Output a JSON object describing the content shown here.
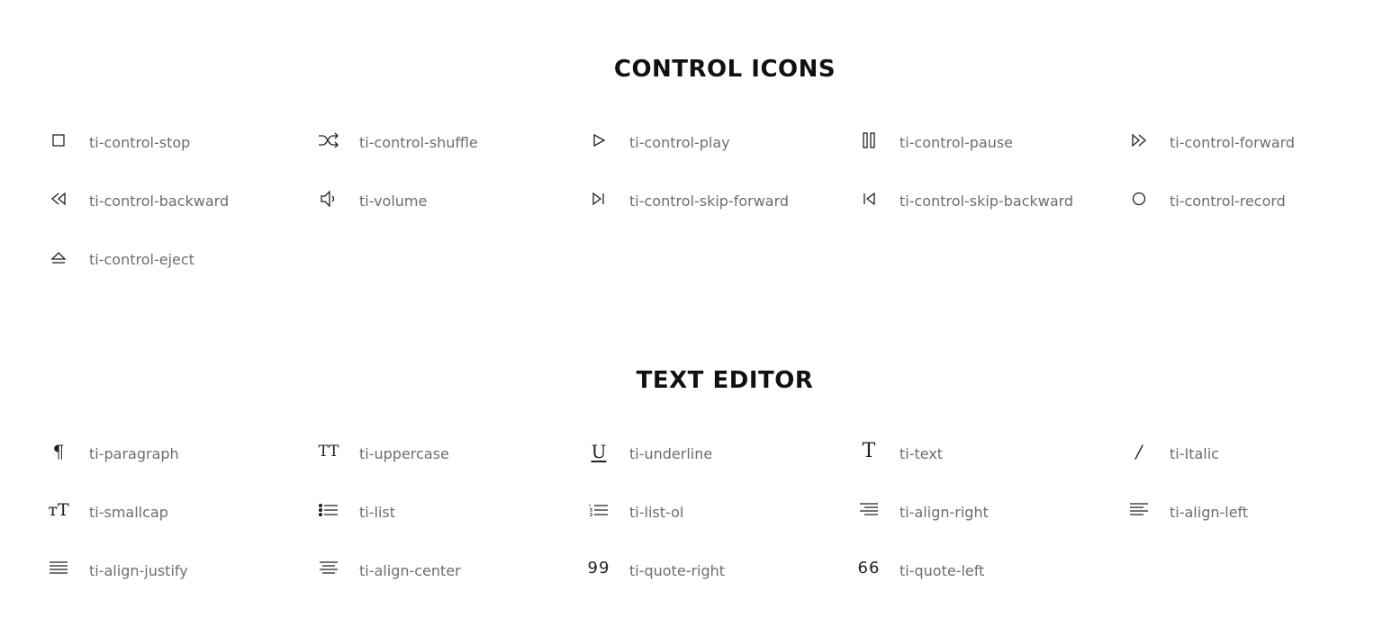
{
  "sections": {
    "control": {
      "title": "CONTROL ICONS",
      "items": [
        {
          "icon": "stop-icon",
          "label": "ti-control-stop"
        },
        {
          "icon": "shuffle-icon",
          "label": "ti-control-shuffle"
        },
        {
          "icon": "play-icon",
          "label": "ti-control-play"
        },
        {
          "icon": "pause-icon",
          "label": "ti-control-pause"
        },
        {
          "icon": "forward-icon",
          "label": "ti-control-forward"
        },
        {
          "icon": "backward-icon",
          "label": "ti-control-backward"
        },
        {
          "icon": "volume-icon",
          "label": "ti-volume"
        },
        {
          "icon": "skip-forward-icon",
          "label": "ti-control-skip-forward"
        },
        {
          "icon": "skip-backward-icon",
          "label": "ti-control-skip-backward"
        },
        {
          "icon": "record-icon",
          "label": "ti-control-record"
        },
        {
          "icon": "eject-icon",
          "label": "ti-control-eject"
        }
      ]
    },
    "text_editor": {
      "title": "TEXT EDITOR",
      "items": [
        {
          "icon": "paragraph-icon",
          "label": "ti-paragraph"
        },
        {
          "icon": "uppercase-icon",
          "label": "ti-uppercase"
        },
        {
          "icon": "underline-icon",
          "label": "ti-underline"
        },
        {
          "icon": "text-icon",
          "label": "ti-text"
        },
        {
          "icon": "italic-icon",
          "label": "ti-Italic"
        },
        {
          "icon": "smallcap-icon",
          "label": "ti-smallcap"
        },
        {
          "icon": "list-icon",
          "label": "ti-list"
        },
        {
          "icon": "list-ol-icon",
          "label": "ti-list-ol"
        },
        {
          "icon": "align-right-icon",
          "label": "ti-align-right"
        },
        {
          "icon": "align-left-icon",
          "label": "ti-align-left"
        },
        {
          "icon": "align-justify-icon",
          "label": "ti-align-justify"
        },
        {
          "icon": "align-center-icon",
          "label": "ti-align-center"
        },
        {
          "icon": "quote-right-icon",
          "label": "ti-quote-right"
        },
        {
          "icon": "quote-left-icon",
          "label": "ti-quote-left"
        }
      ]
    }
  },
  "glyphs": {
    "paragraph": "¶",
    "uppercase": "TT",
    "underline": "U",
    "text": "T",
    "italic": "/",
    "smallcap": "тT",
    "quote_right": "99",
    "quote_left": "66"
  }
}
